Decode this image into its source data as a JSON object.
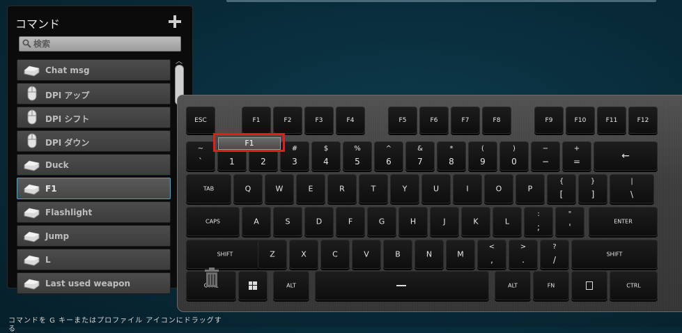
{
  "panel": {
    "title": "コマンド",
    "search_placeholder": "検索",
    "commands": [
      {
        "label": "Chat msg",
        "icon": "keyboard-key-icon"
      },
      {
        "label": "DPI アップ",
        "icon": "mouse-icon"
      },
      {
        "label": "DPI シフト",
        "icon": "mouse-icon"
      },
      {
        "label": "DPI ダウン",
        "icon": "mouse-icon"
      },
      {
        "label": "Duck",
        "icon": "keyboard-key-icon"
      },
      {
        "label": "F1",
        "icon": "keyboard-key-icon",
        "selected": true
      },
      {
        "label": "Flashlight",
        "icon": "keyboard-key-icon"
      },
      {
        "label": "Jump",
        "icon": "keyboard-key-icon"
      },
      {
        "label": "L",
        "icon": "keyboard-key-icon"
      },
      {
        "label": "Last used weapon",
        "icon": "keyboard-key-icon"
      }
    ]
  },
  "hint": {
    "line1": "コマンドを G キーまたはプロファイル アイコンにドラッグす",
    "line2": "る"
  },
  "drag_label": "F1",
  "colors": {
    "accent_selection": "#3fa9d8",
    "drag_highlight": "#e11d1d"
  },
  "keyboard": {
    "fn_row": [
      "ESC",
      "F1",
      "F2",
      "F3",
      "F4",
      "F5",
      "F6",
      "F7",
      "F8",
      "F9",
      "F10",
      "F11",
      "F12"
    ],
    "num_row": [
      {
        "top": "~",
        "bottom": "`"
      },
      {
        "top": "!",
        "bottom": "1"
      },
      {
        "top": "@",
        "bottom": "2"
      },
      {
        "top": "#",
        "bottom": "3"
      },
      {
        "top": "$",
        "bottom": "4"
      },
      {
        "top": "%",
        "bottom": "5"
      },
      {
        "top": "^",
        "bottom": "6"
      },
      {
        "top": "&",
        "bottom": "7"
      },
      {
        "top": "*",
        "bottom": "8"
      },
      {
        "top": "(",
        "bottom": "9"
      },
      {
        "top": ")",
        "bottom": "0"
      },
      {
        "top": "−",
        "bottom": "−"
      },
      {
        "top": "+",
        "bottom": "="
      }
    ],
    "backspace": "←",
    "tab": "TAB",
    "row_q": [
      "Q",
      "W",
      "E",
      "R",
      "T",
      "Y",
      "U",
      "I",
      "O",
      "P"
    ],
    "row_q_sym": [
      {
        "top": "{",
        "bottom": "["
      },
      {
        "top": "}",
        "bottom": "]"
      },
      {
        "top": "|",
        "bottom": "\\"
      }
    ],
    "caps": "CAPS",
    "row_a": [
      "A",
      "S",
      "D",
      "F",
      "G",
      "H",
      "J",
      "K",
      "L"
    ],
    "row_a_sym": [
      {
        "top": ":",
        "bottom": ";"
      },
      {
        "top": "\"",
        "bottom": "'"
      }
    ],
    "enter": "ENTER",
    "shift": "SHIFT",
    "row_z": [
      "Z",
      "X",
      "C",
      "V",
      "B",
      "N",
      "M"
    ],
    "row_z_sym": [
      {
        "top": "<",
        "bottom": ","
      },
      {
        "top": ">",
        "bottom": "."
      },
      {
        "top": "?",
        "bottom": "/"
      }
    ],
    "shift_r": "SHIFT",
    "ctrl": "CTRL",
    "alt": "ALT",
    "fn": "FN",
    "ctrl_r": "CTRL"
  }
}
